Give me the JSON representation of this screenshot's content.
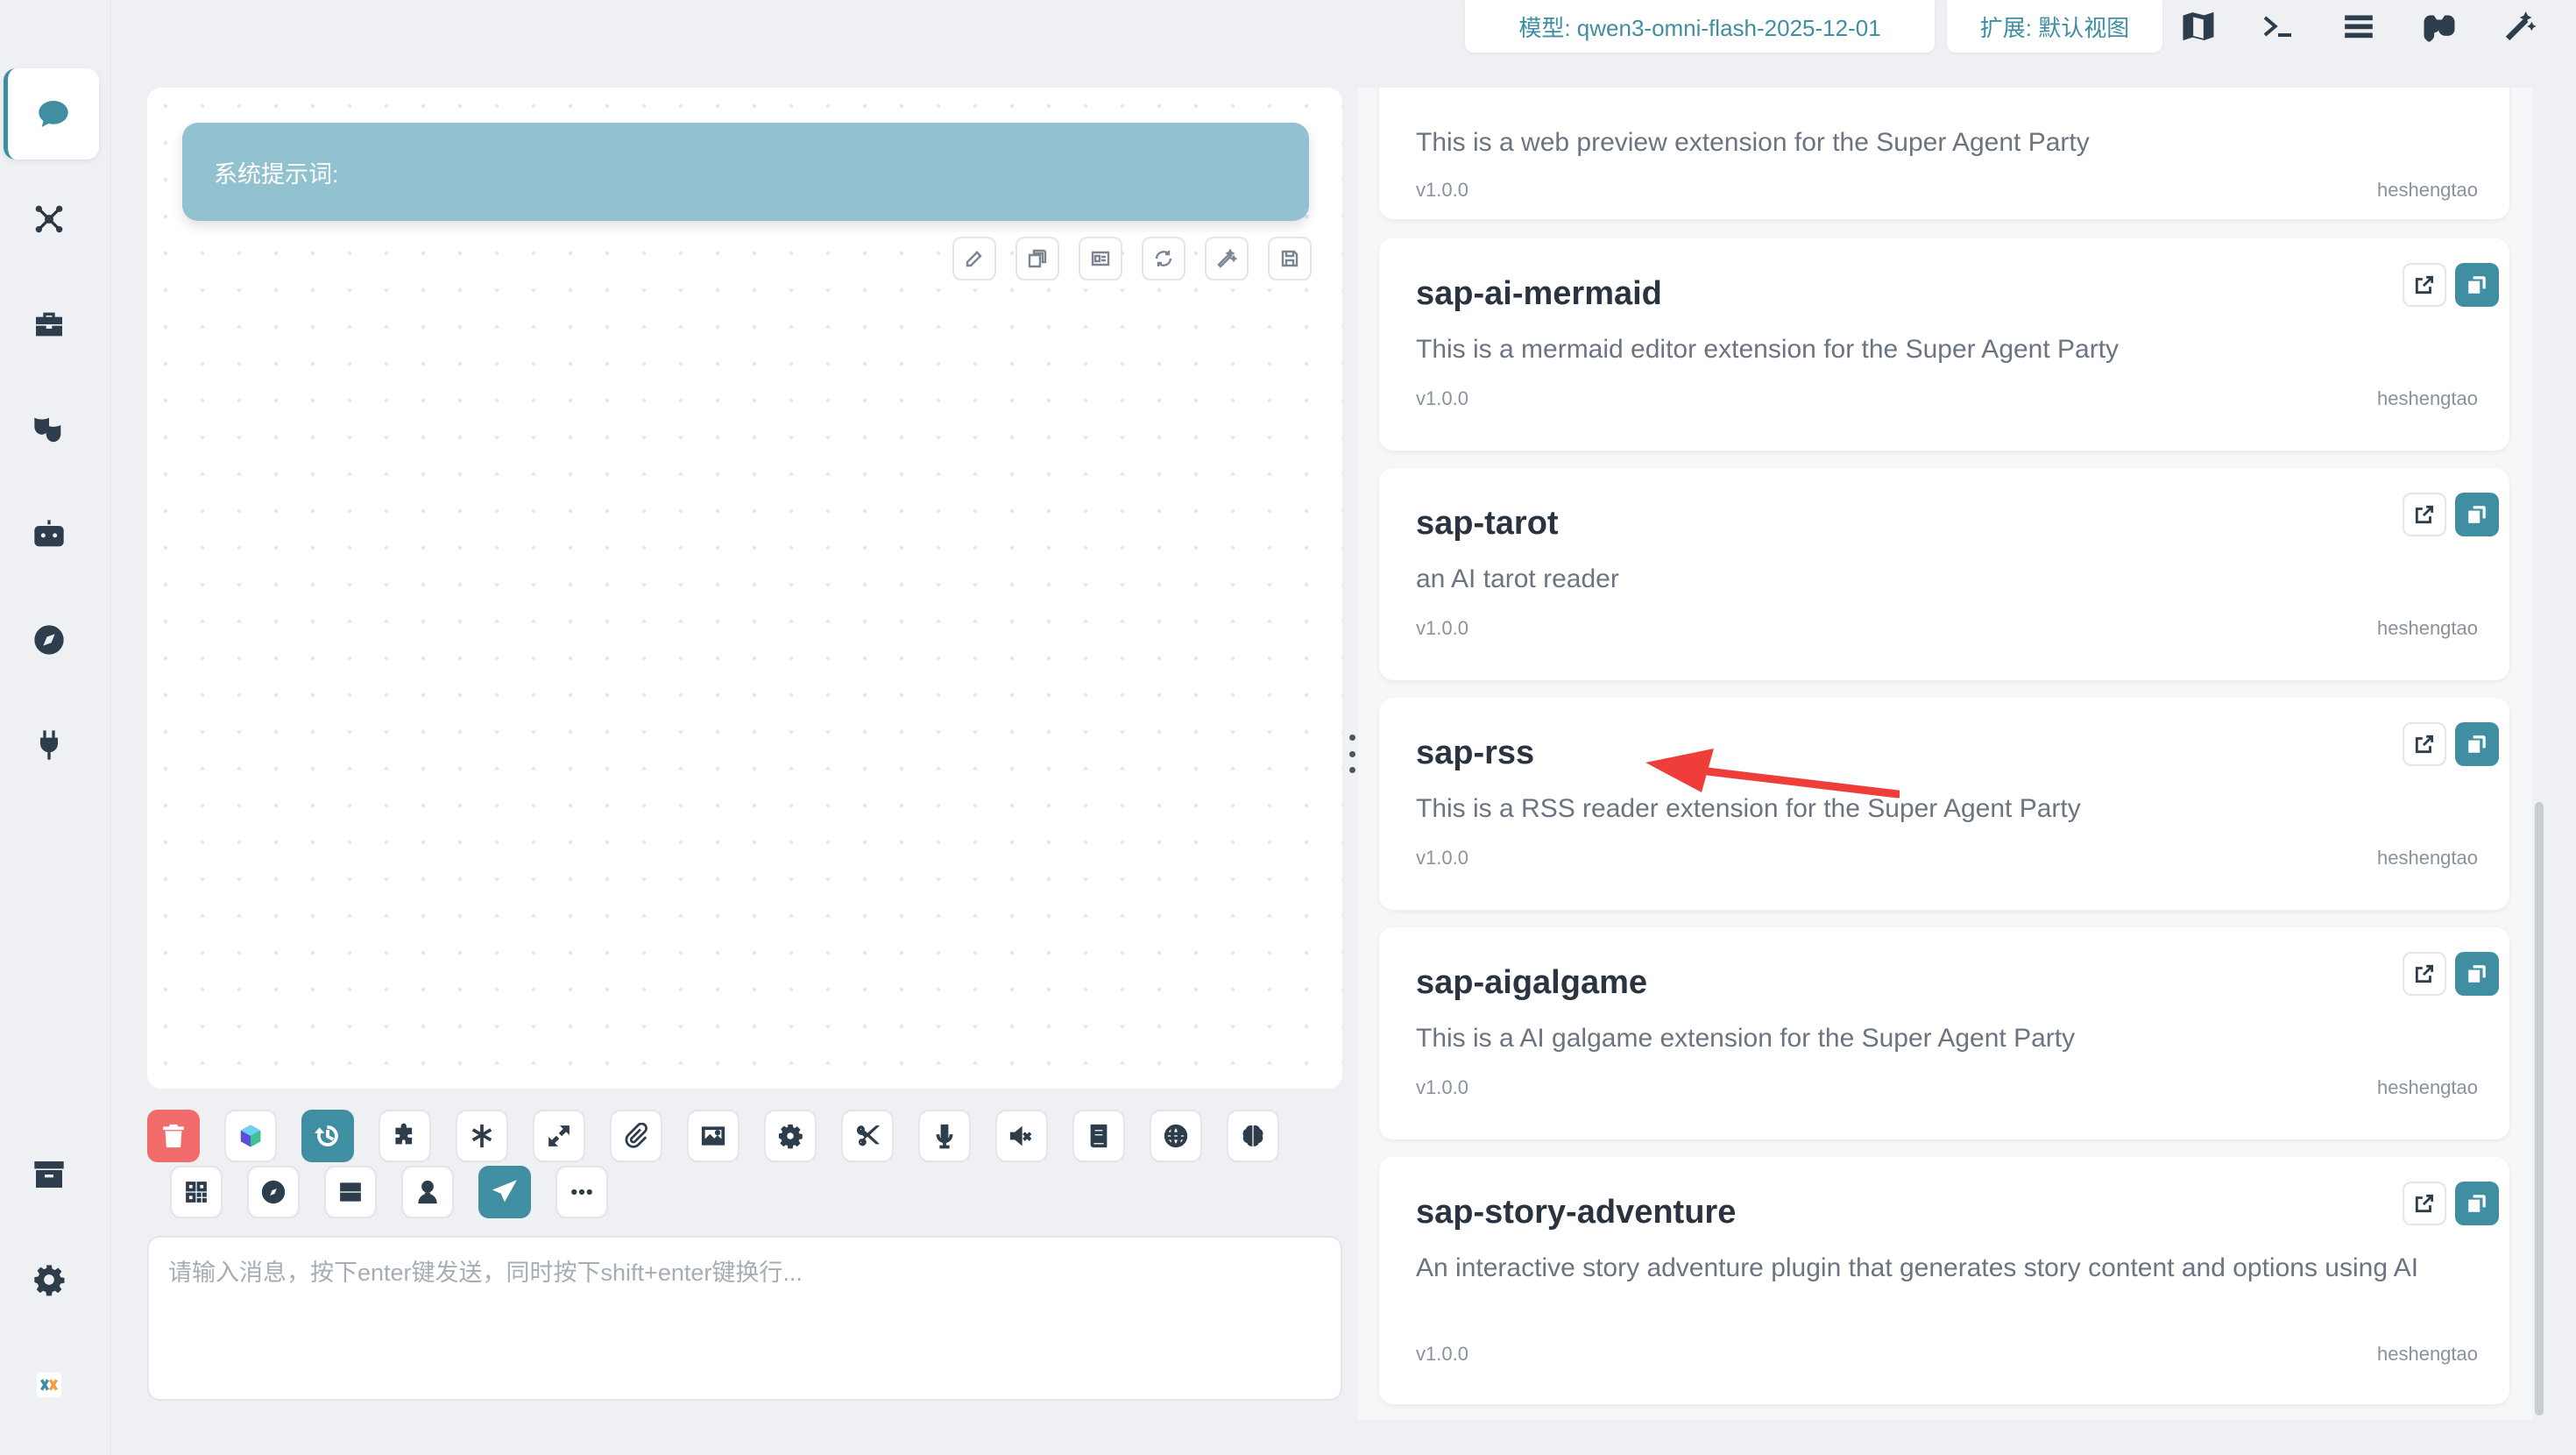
{
  "rail": {
    "items": [
      {
        "id": "chat",
        "icon": "chat-bubble-icon",
        "active": true
      },
      {
        "id": "network",
        "icon": "network-icon",
        "active": false
      },
      {
        "id": "toolbox",
        "icon": "toolbox-icon",
        "active": false
      },
      {
        "id": "roles",
        "icon": "theater-masks-icon",
        "active": false
      },
      {
        "id": "robot",
        "icon": "robot-icon",
        "active": false
      },
      {
        "id": "explore",
        "icon": "compass-icon",
        "active": false
      },
      {
        "id": "plugins",
        "icon": "plug-icon",
        "active": false
      },
      {
        "id": "archive",
        "icon": "archive-icon",
        "active": false
      },
      {
        "id": "settings",
        "icon": "gear-icon",
        "active": false
      },
      {
        "id": "logo",
        "icon": "app-logo-icon",
        "active": false
      }
    ]
  },
  "topbar": {
    "model_tag": "模型: qwen3-omni-flash-2025-12-01",
    "extension_tag": "扩展: 默认视图",
    "icons": [
      "map-icon",
      "terminal-icon",
      "menu-icon",
      "glasses-icon",
      "magic-wand-icon"
    ]
  },
  "chat": {
    "system_prompt_label": "系统提示词:",
    "mini_actions": [
      "edit-icon",
      "copy-icon",
      "id-card-icon",
      "refresh-icon",
      "magic-wand-icon",
      "save-icon"
    ],
    "input_placeholder": "请输入消息，按下enter键发送，同时按下shift+enter键换行...",
    "toolbar_row1": [
      "trash-icon",
      "logo-cube-icon",
      "history-icon",
      "puzzle-icon",
      "asterisk-icon",
      "expand-icon",
      "paperclip-icon",
      "image-icon",
      "gear-icon",
      "scissors-icon",
      "microphone-icon",
      "mute-icon",
      "book-icon",
      "globe-icon",
      "brain-icon"
    ],
    "toolbar_row2": [
      "qr-code-icon",
      "compass-icon",
      "server-icon",
      "user-tie-icon",
      "send-icon",
      "more-icon"
    ]
  },
  "extensions": [
    {
      "name": "",
      "description": "This is a web preview extension for the Super Agent Party",
      "version": "v1.0.0",
      "author": "heshengtao"
    },
    {
      "name": "sap-ai-mermaid",
      "description": "This is a mermaid editor extension for the Super Agent Party",
      "version": "v1.0.0",
      "author": "heshengtao"
    },
    {
      "name": "sap-tarot",
      "description": "an AI tarot reader",
      "version": "v1.0.0",
      "author": "heshengtao"
    },
    {
      "name": "sap-rss",
      "description": "This is a RSS reader extension for the Super Agent Party",
      "version": "v1.0.0",
      "author": "heshengtao"
    },
    {
      "name": "sap-aigalgame",
      "description": "This is a AI galgame extension for the Super Agent Party",
      "version": "v1.0.0",
      "author": "heshengtao"
    },
    {
      "name": "sap-story-adventure",
      "description": "An interactive story adventure plugin that generates story content and options using AI",
      "version": "v1.0.0",
      "author": "heshengtao"
    }
  ],
  "colors": {
    "accent": "#3f8ea1",
    "system_prompt_bg": "#92c1cf",
    "danger": "#f26b6b",
    "annotation_arrow": "#ef3e3a"
  }
}
